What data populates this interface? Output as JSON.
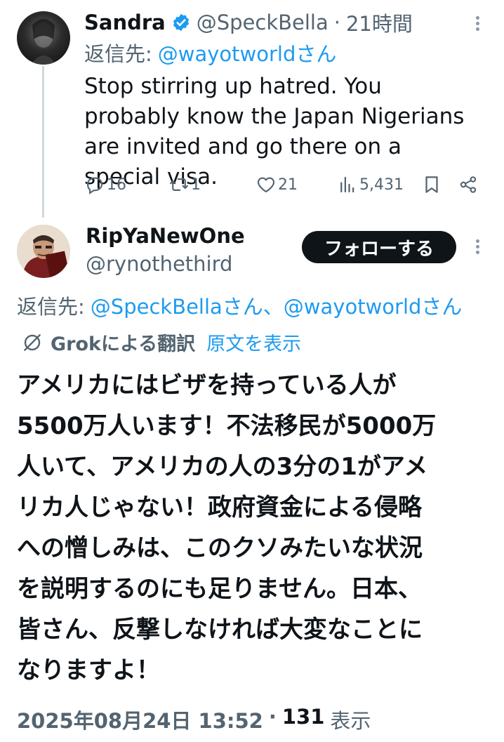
{
  "tweet1": {
    "display_name": "Sandra",
    "handle": "@SpeckBella",
    "separator": "·",
    "time": "21時間",
    "reply_label": "返信先:",
    "reply_to": "@wayotworldさん",
    "body": "Stop stirring up hatred. You probably know the Japan Nigerians are invited and go there on a special visa.",
    "stats": {
      "replies": "16",
      "reposts": "1",
      "likes": "21",
      "views": "5,431"
    }
  },
  "tweet2": {
    "display_name": "RipYaNewOne",
    "handle": "@rynothethird",
    "follow_label": "フォローする",
    "reply_label": "返信先:",
    "reply_to": "@SpeckBellaさん、@wayotworldさん",
    "translate_label": "Grokによる翻訳",
    "show_original": "原文を表示",
    "body_lines": [
      "アメリカにはビザを持っている人が",
      "5500万人います！不法移民が5000万",
      "人いて、アメリカの人の3分の1がアメ",
      "リカ人じゃない！政府資金による侵略",
      "への憎しみは、このクソみたいな状況",
      "を説明するのにも足りません。日本、",
      "皆さん、反撃しなければ大変なことに",
      "なりますよ！"
    ],
    "timestamp": "2025年08月24日 13:52",
    "separator": "·",
    "view_count": "131",
    "view_label": "表示"
  }
}
